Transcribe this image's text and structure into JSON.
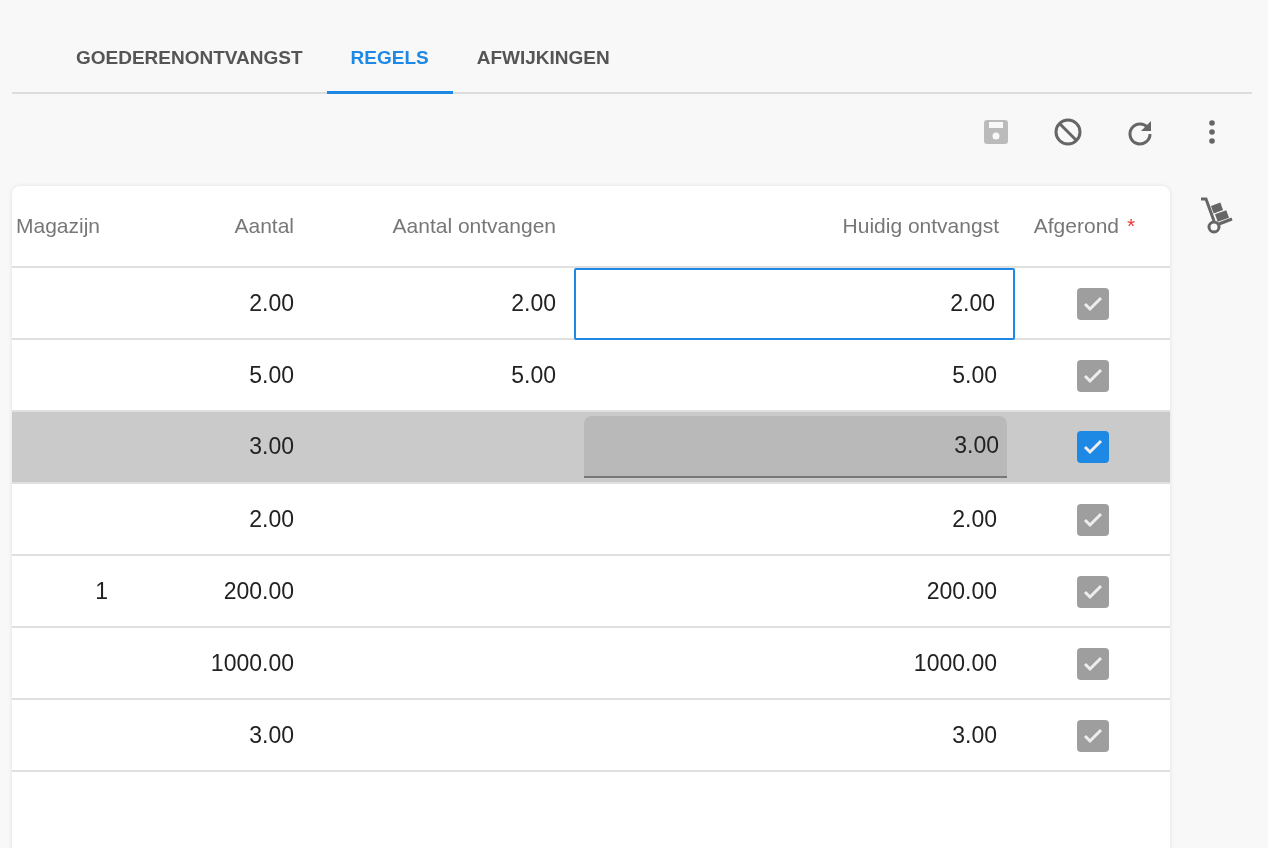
{
  "tabs": [
    {
      "label": "GOEDERENONTVANGST",
      "selected": false
    },
    {
      "label": "REGELS",
      "selected": true
    },
    {
      "label": "AFWIJKINGEN",
      "selected": false
    }
  ],
  "toolbar": [
    {
      "kind": "save",
      "disabled": true
    },
    {
      "kind": "cancel",
      "disabled": false
    },
    {
      "kind": "refresh",
      "disabled": false
    },
    {
      "kind": "more",
      "disabled": false
    }
  ],
  "table": {
    "columns": [
      {
        "label": "Magazijn"
      },
      {
        "label": "Aantal"
      },
      {
        "label": "Aantal ontvangen"
      },
      {
        "label": "Huidig ontvangst"
      },
      {
        "label": "Afgerond",
        "required_mark": "*"
      }
    ],
    "rows": [
      {
        "magazijn": "",
        "aantal": "2.00",
        "ontvangen": "2.00",
        "huidig": "2.00",
        "afgerond": true,
        "selected": false,
        "focused": true
      },
      {
        "magazijn": "",
        "aantal": "5.00",
        "ontvangen": "5.00",
        "huidig": "5.00",
        "afgerond": true,
        "selected": false,
        "focused": false
      },
      {
        "magazijn": "",
        "aantal": "3.00",
        "ontvangen": "",
        "huidig": "3.00",
        "afgerond": true,
        "selected": true,
        "focused": false
      },
      {
        "magazijn": "",
        "aantal": "2.00",
        "ontvangen": "",
        "huidig": "2.00",
        "afgerond": true,
        "selected": false,
        "focused": false
      },
      {
        "magazijn": "1",
        "aantal": "200.00",
        "ontvangen": "",
        "huidig": "200.00",
        "afgerond": true,
        "selected": false,
        "focused": false
      },
      {
        "magazijn": "",
        "aantal": "1000.00",
        "ontvangen": "",
        "huidig": "1000.00",
        "afgerond": true,
        "selected": false,
        "focused": false
      },
      {
        "magazijn": "",
        "aantal": "3.00",
        "ontvangen": "",
        "huidig": "3.00",
        "afgerond": true,
        "selected": false,
        "focused": false
      }
    ]
  }
}
